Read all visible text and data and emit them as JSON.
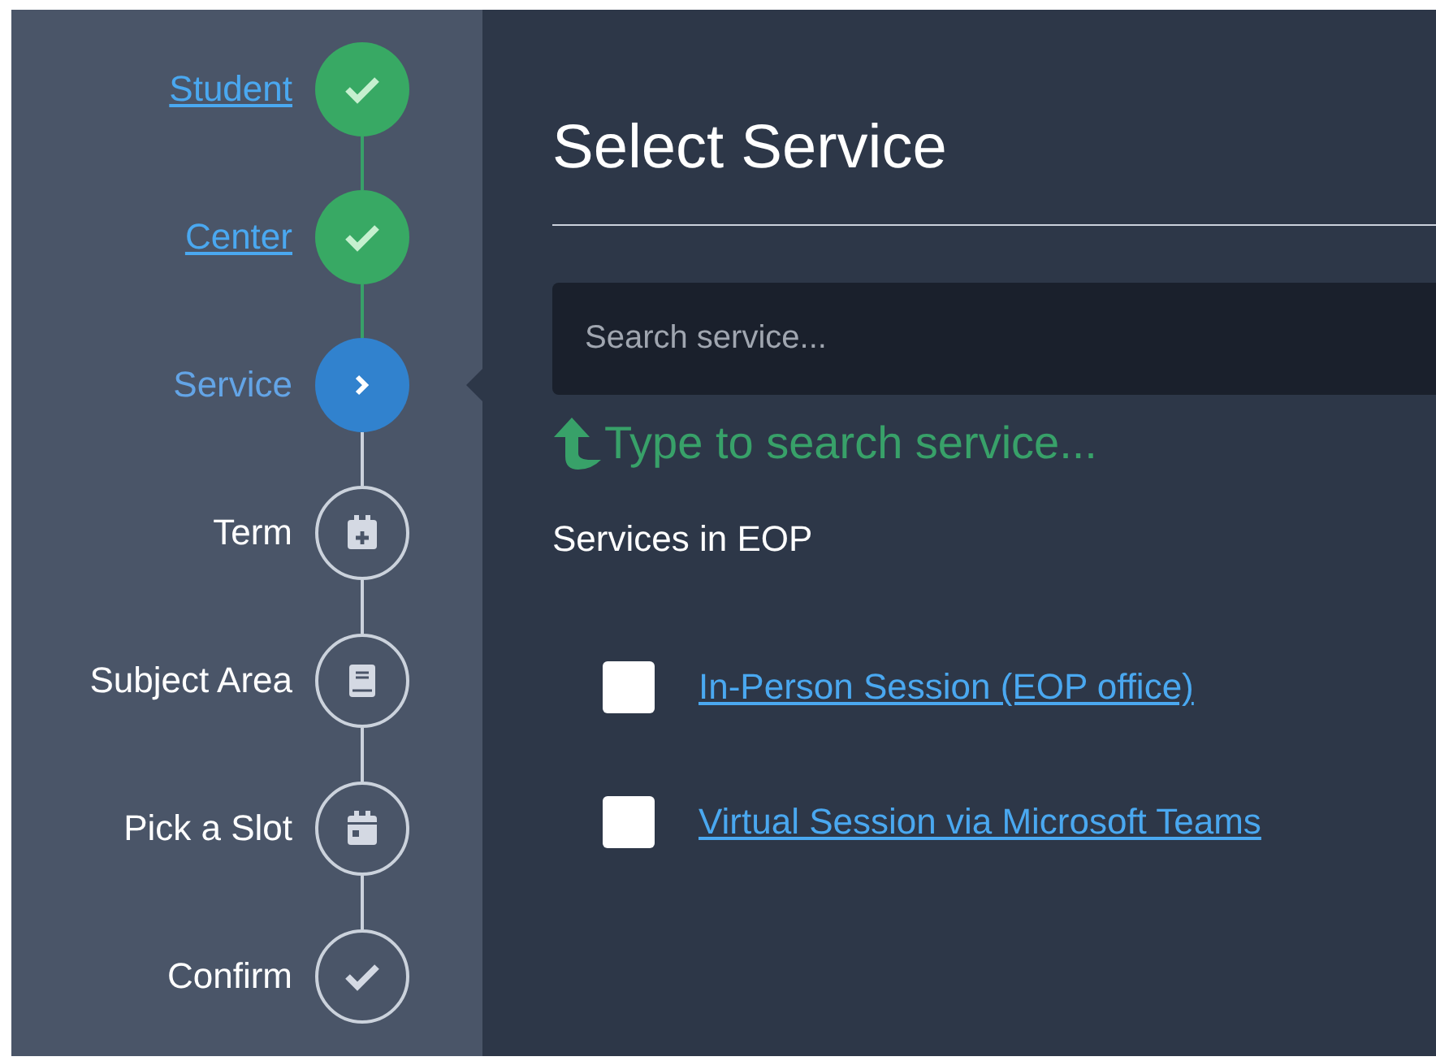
{
  "steps": [
    {
      "label": "Student",
      "completed": true,
      "selected": false
    },
    {
      "label": "Center",
      "completed": true,
      "selected": false
    },
    {
      "label": "Service",
      "completed": false,
      "selected": true
    },
    {
      "label": "Term",
      "completed": false,
      "selected": false
    },
    {
      "label": "Subject Area",
      "completed": false,
      "selected": false
    },
    {
      "label": "Pick a Slot",
      "completed": false,
      "selected": false
    },
    {
      "label": "Confirm",
      "completed": false,
      "selected": false
    }
  ],
  "title": "Select Service",
  "search": {
    "placeholder": "Search service..."
  },
  "hint": "Type to search service...",
  "section_label": "Services in EOP",
  "services": [
    {
      "label": "In-Person Session (EOP office)",
      "checked": false
    },
    {
      "label": "Virtual Session via Microsoft Teams",
      "checked": false
    }
  ]
}
